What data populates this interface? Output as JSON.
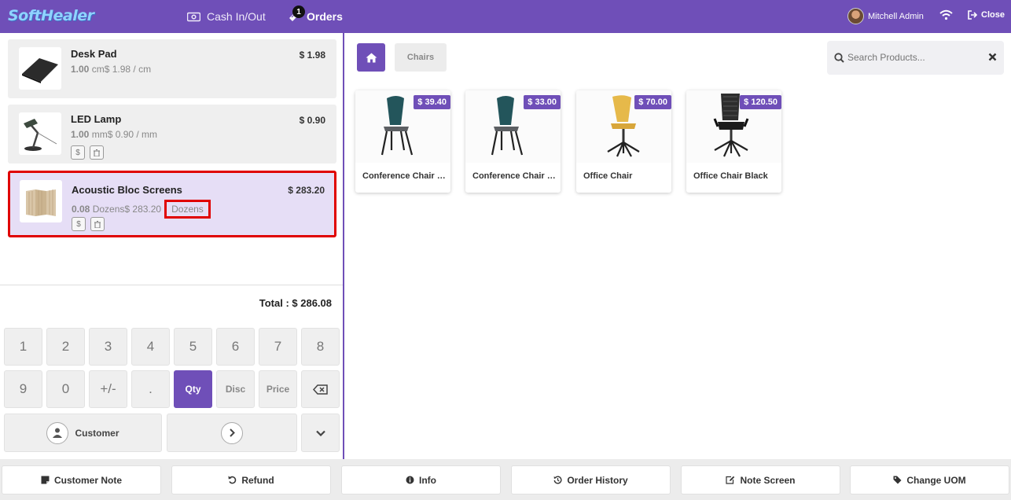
{
  "header": {
    "logo": "SoftHealer",
    "cash_label": "Cash In/Out",
    "orders_label": "Orders",
    "orders_badge": "1",
    "user_name": "Mitchell Admin",
    "close_label": "Close",
    "accent_color": "#6f4fb8"
  },
  "order_lines": [
    {
      "name": "Desk Pad",
      "price": "$ 1.98",
      "qty": "1.00",
      "unit_text": "cm$ 1.98 / cm"
    },
    {
      "name": "LED Lamp",
      "price": "$ 0.90",
      "qty": "1.00",
      "unit_text": "mm$ 0.90 / mm"
    },
    {
      "name": "Acoustic Bloc Screens",
      "price": "$ 283.20",
      "qty": "0.08",
      "unit_text": "Dozens$ 283.20",
      "uom_tag": "Dozens"
    }
  ],
  "line_icons": {
    "price": "$",
    "delete": "🗑"
  },
  "total_label": "Total : $ 286.08",
  "numpad": {
    "row1": [
      "1",
      "2",
      "3",
      "4",
      "5",
      "6",
      "7",
      "8"
    ],
    "row2": [
      "9",
      "0",
      "+/-",
      ".",
      "Qty",
      "Disc",
      "Price",
      "⌫"
    ],
    "active": "Qty"
  },
  "customer_label": "Customer",
  "category": "Chairs",
  "search": {
    "placeholder": "Search Products..."
  },
  "products": [
    {
      "name": "Conference Chair (Steel)",
      "price": "$ 39.40"
    },
    {
      "name": "Conference Chair (Aluminium)",
      "price": "$ 33.00"
    },
    {
      "name": "Office Chair",
      "price": "$ 70.00"
    },
    {
      "name": "Office Chair Black",
      "price": "$ 120.50"
    }
  ],
  "bottom_buttons": [
    {
      "label": "Customer Note",
      "icon": "note-icon"
    },
    {
      "label": "Refund",
      "icon": "undo-icon"
    },
    {
      "label": "Info",
      "icon": "info-icon"
    },
    {
      "label": "Order History",
      "icon": "history-icon"
    },
    {
      "label": "Note Screen",
      "icon": "edit-icon"
    },
    {
      "label": "Change UOM",
      "icon": "tag-icon"
    }
  ]
}
